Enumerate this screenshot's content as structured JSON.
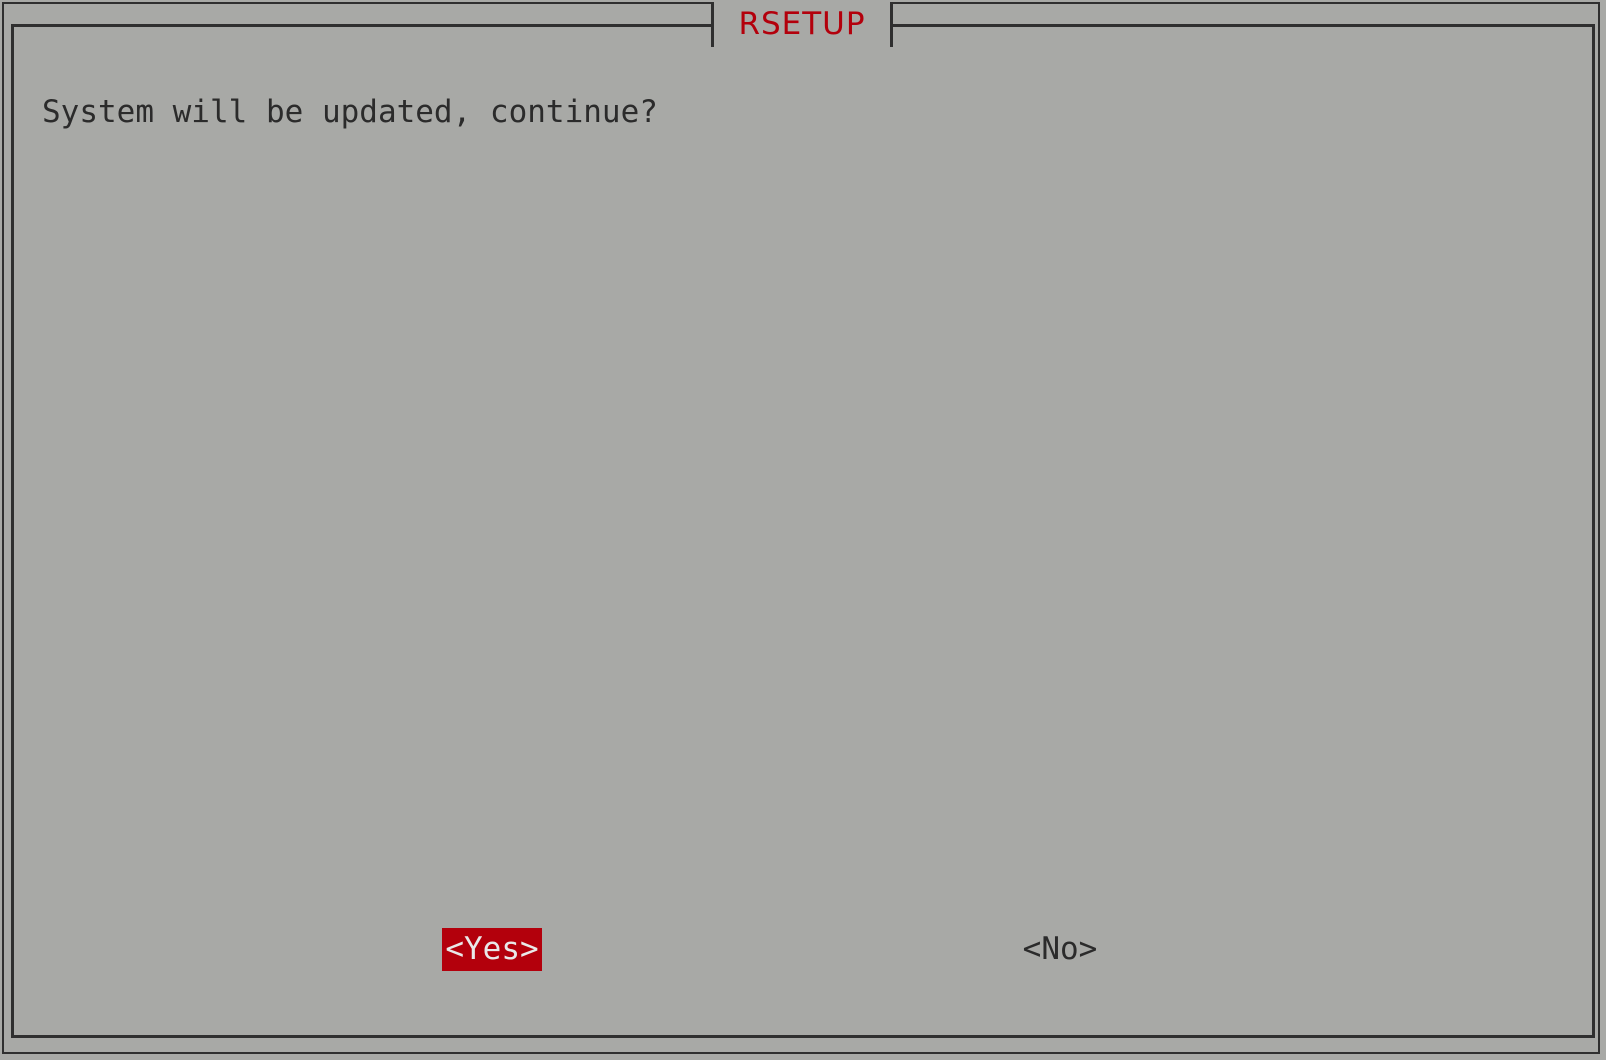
{
  "dialog": {
    "title": "RSETUP",
    "message": "System will be updated, continue?",
    "buttons": {
      "yes_label": "<Yes>",
      "no_label": "<No>"
    },
    "selected_button": "yes"
  },
  "colors": {
    "background": "#a8a9a6",
    "frame": "#2f2f2f",
    "accent": "#b3000c",
    "text": "#2b2b2b",
    "selected_text": "#e9e9e9"
  }
}
